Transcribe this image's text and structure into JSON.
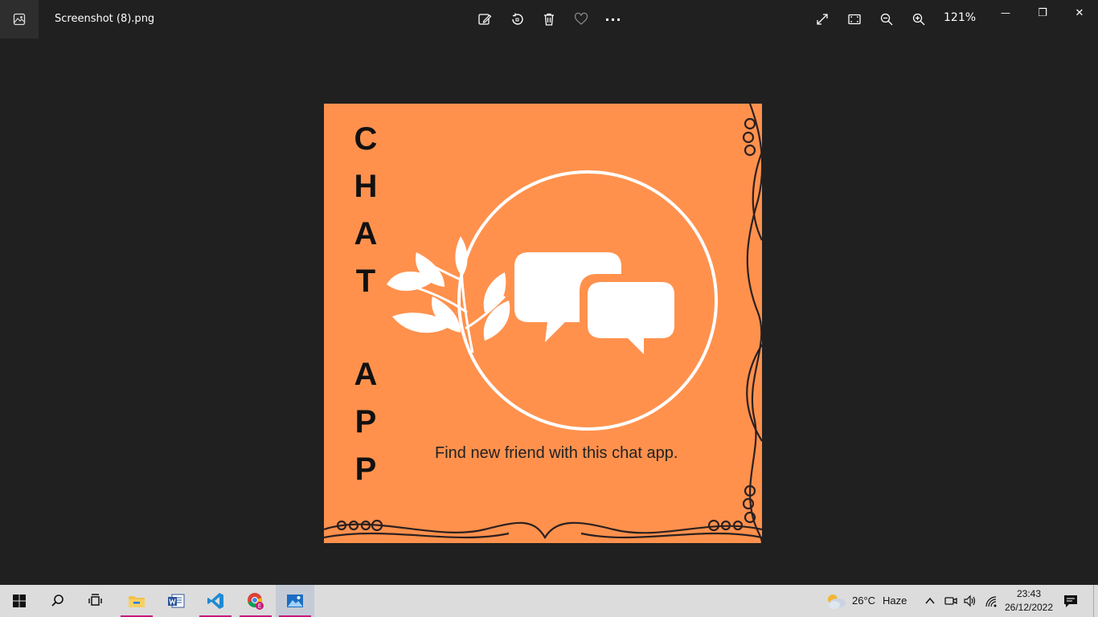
{
  "window": {
    "title": "Screenshot (8).png",
    "zoom": "121%"
  },
  "toolbar": {
    "icons": [
      "edit-image-icon",
      "rotate-icon",
      "delete-icon",
      "favorite-icon",
      "more-icon"
    ],
    "more_label": "···"
  },
  "view_controls": {
    "icons": [
      "fullscreen-icon",
      "fit-to-window-icon",
      "zoom-out-icon",
      "zoom-in-icon"
    ]
  },
  "window_controls": {
    "minimize": "—",
    "maximize": "❐",
    "close": "✕"
  },
  "image": {
    "background": "#ff914d",
    "vertical_letters": [
      "C",
      "H",
      "A",
      "T",
      "A",
      "P",
      "P"
    ],
    "tagline": "Find new friend with this chat app."
  },
  "taskbar": {
    "apps": [
      "start",
      "search",
      "task-view",
      "file-explorer",
      "word",
      "vscode",
      "chrome",
      "photos"
    ],
    "weather_temp": "26°C",
    "weather_desc": "Haze",
    "time": "23:43",
    "date": "26/12/2022"
  }
}
